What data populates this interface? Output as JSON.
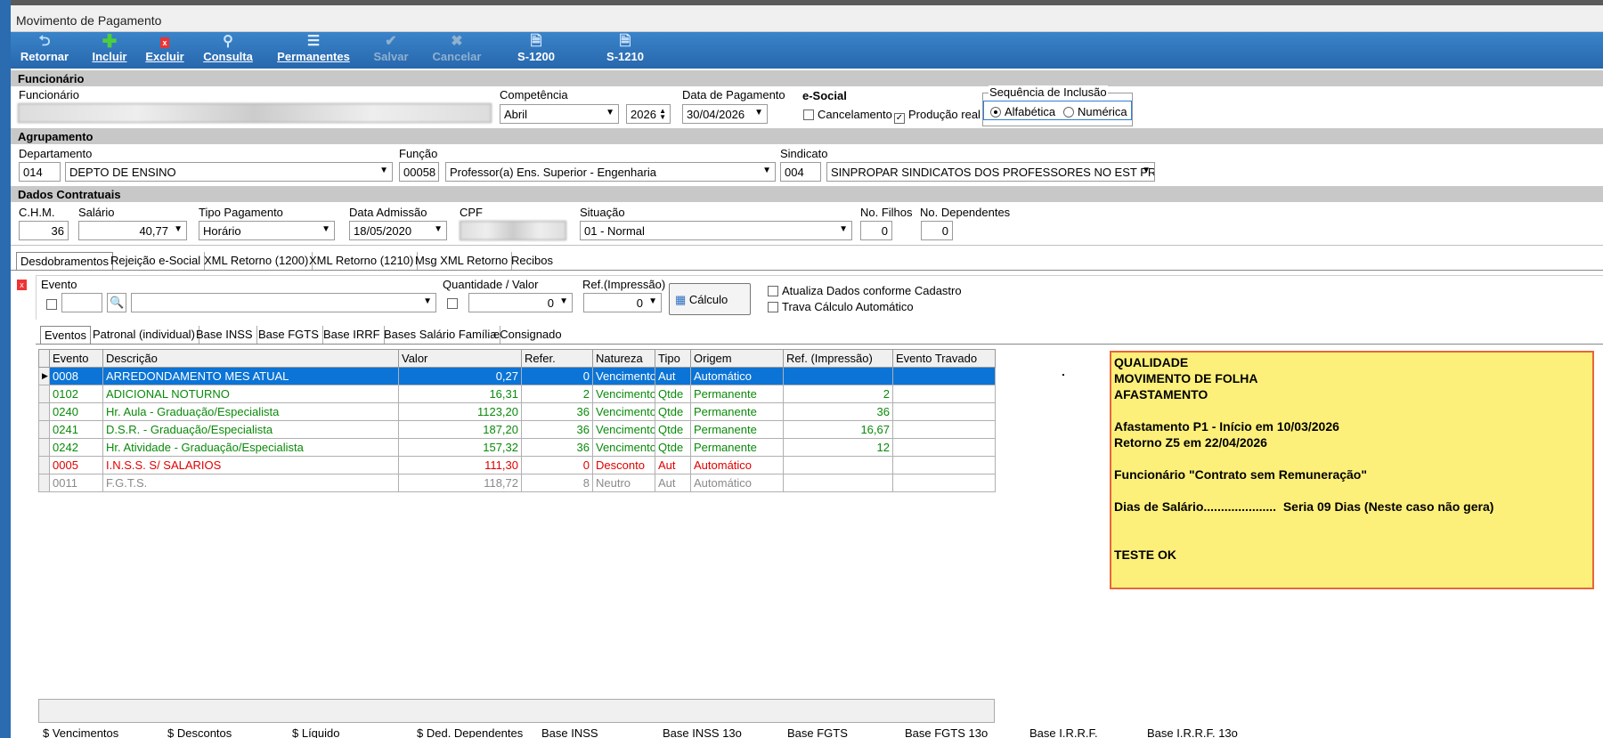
{
  "window": {
    "title": "Movimento de Pagamento"
  },
  "toolbar": {
    "retornar": "Retornar",
    "incluir": "Incluir",
    "excluir": "Excluir",
    "consulta": "Consulta",
    "permanentes": "Permanentes",
    "salvar": "Salvar",
    "cancelar": "Cancelar",
    "s1200": "S-1200",
    "s1210": "S-1210"
  },
  "funcionario": {
    "section": "Funcionário",
    "label": "Funcionário",
    "competencia_label": "Competência",
    "competencia_mes": "Abril",
    "competencia_ano": "2026",
    "data_pag_label": "Data de Pagamento",
    "data_pag": "30/04/2026",
    "esocial_label": "e-Social",
    "cancelamento": "Cancelamento",
    "producao_real": "Produção real",
    "sequencia_label": "Sequência de Inclusão",
    "alfabetica": "Alfabética",
    "numerica": "Numérica"
  },
  "agrupamento": {
    "section": "Agrupamento",
    "departamento_label": "Departamento",
    "departamento_cod": "014",
    "departamento": "DEPTO DE ENSINO",
    "funcao_label": "Função",
    "funcao_cod": "00058",
    "funcao": "Professor(a) Ens. Superior -  Engenharia",
    "sindicato_label": "Sindicato",
    "sindicato_cod": "004",
    "sindicato": "SINPROPAR SINDICATOS DOS PROFESSORES NO EST PR"
  },
  "contrato": {
    "section": "Dados Contratuais",
    "chm_label": "C.H.M.",
    "chm": "36",
    "salario_label": "Salário",
    "salario": "40,77",
    "tipo_label": "Tipo Pagamento",
    "tipo": "Horário",
    "admissao_label": "Data Admissão",
    "admissao": "18/05/2020",
    "cpf_label": "CPF",
    "situacao_label": "Situação",
    "situacao": "01 - Normal",
    "filhos_label": "No. Filhos",
    "filhos": "0",
    "dependentes_label": "No. Dependentes",
    "dependentes": "0"
  },
  "main_tabs": [
    "Desdobramentos",
    "Rejeição e-Social",
    "XML Retorno (1200)",
    "XML Retorno (1210)",
    "Msg XML Retorno",
    "Recibos"
  ],
  "evento_form": {
    "evento_label": "Evento",
    "qtd_label": "Quantidade / Valor",
    "qtd": "0",
    "ref_label": "Ref.(Impressão)",
    "ref": "0",
    "calculo": "Cálculo",
    "atualiza": "Atualiza Dados conforme Cadastro",
    "trava": "Trava Cálculo Automático"
  },
  "sub_tabs": [
    "Eventos",
    "Patronal (individual)",
    "Base INSS",
    "Base FGTS",
    "Base IRRF",
    "Bases Salário Família",
    "eConsignado"
  ],
  "grid": {
    "headers": [
      "Evento",
      "Descrição",
      "Valor",
      "Refer.",
      "Natureza",
      "Tipo",
      "Origem",
      "Ref. (Impressão)",
      "Evento Travado"
    ],
    "rows": [
      {
        "evento": "0008",
        "descricao": "ARREDONDAMENTO MES ATUAL",
        "valor": "0,27",
        "refer": "0",
        "natureza": "Vencimento",
        "tipo": "Aut",
        "origem": "Automático",
        "refimp": ""
      },
      {
        "evento": "0102",
        "descricao": "ADICIONAL NOTURNO",
        "valor": "16,31",
        "refer": "2",
        "natureza": "Vencimento",
        "tipo": "Qtde",
        "origem": "Permanente",
        "refimp": "2"
      },
      {
        "evento": "0240",
        "descricao": "Hr. Aula - Graduação/Especialista",
        "valor": "1123,20",
        "refer": "36",
        "natureza": "Vencimento",
        "tipo": "Qtde",
        "origem": "Permanente",
        "refimp": "36"
      },
      {
        "evento": "0241",
        "descricao": "D.S.R. - Graduação/Especialista",
        "valor": "187,20",
        "refer": "36",
        "natureza": "Vencimento",
        "tipo": "Qtde",
        "origem": "Permanente",
        "refimp": "16,67"
      },
      {
        "evento": "0242",
        "descricao": "Hr. Atividade - Graduação/Especialista",
        "valor": "157,32",
        "refer": "36",
        "natureza": "Vencimento",
        "tipo": "Qtde",
        "origem": "Permanente",
        "refimp": "12"
      },
      {
        "evento": "0005",
        "descricao": "I.N.S.S. S/ SALARIOS",
        "valor": "111,30",
        "refer": "0",
        "natureza": "Desconto",
        "tipo": "Aut",
        "origem": "Automático",
        "refimp": ""
      },
      {
        "evento": "0011",
        "descricao": "F.G.T.S.",
        "valor": "118,72",
        "refer": "8",
        "natureza": "Neutro",
        "tipo": "Aut",
        "origem": "Automático",
        "refimp": ""
      }
    ]
  },
  "note": {
    "lines": [
      "QUALIDADE",
      "MOVIMENTO DE FOLHA",
      "AFASTAMENTO",
      "",
      "Afastamento P1 - Início em 10/03/2026",
      "Retorno Z5 em 22/04/2026",
      "",
      "Funcionário \"Contrato sem Remuneração\"",
      "",
      "Dias de Salário.....................  Seria 09 Dias (Neste caso não gera)",
      "",
      "",
      "TESTE OK"
    ]
  },
  "footer": [
    "$ Vencimentos",
    "$ Descontos",
    "$ Líquido",
    "$ Ded. Dependentes",
    "Base INSS",
    "Base INSS 13o",
    "Base FGTS",
    "Base FGTS 13o",
    "Base I.R.R.F.",
    "Base I.R.R.F. 13o"
  ]
}
